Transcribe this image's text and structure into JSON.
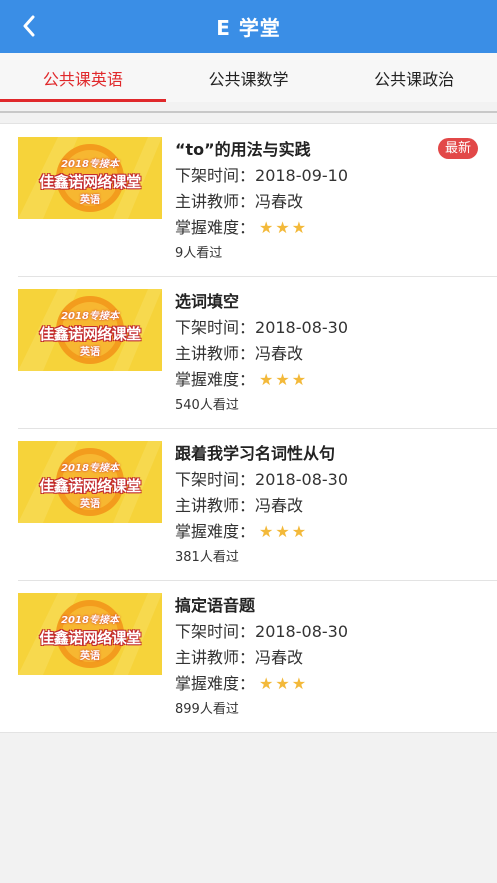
{
  "header": {
    "title": "E 学堂",
    "back_icon": "chevron-left-icon"
  },
  "tabs": [
    {
      "label": "公共课英语",
      "active": true
    },
    {
      "label": "公共课数学",
      "active": false
    },
    {
      "label": "公共课政治",
      "active": false
    }
  ],
  "thumbnail": {
    "year_text": "2018专接本",
    "title_text": "佳鑫诺网络课堂",
    "subject_text": "英语"
  },
  "courses": [
    {
      "title": "“to”的用法与实践",
      "badge": "最新",
      "offline_label": "下架时间：",
      "offline_date": "2018-09-10",
      "teacher_label": "主讲教师：",
      "teacher": "冯春改",
      "difficulty_label": "掌握难度：",
      "stars": "★★★",
      "views": "9人看过"
    },
    {
      "title": "选词填空",
      "offline_label": "下架时间：",
      "offline_date": "2018-08-30",
      "teacher_label": "主讲教师：",
      "teacher": "冯春改",
      "difficulty_label": "掌握难度：",
      "stars": "★★★",
      "views": "540人看过"
    },
    {
      "title": "跟着我学习名词性从句",
      "offline_label": "下架时间：",
      "offline_date": "2018-08-30",
      "teacher_label": "主讲教师：",
      "teacher": "冯春改",
      "difficulty_label": "掌握难度：",
      "stars": "★★★",
      "views": "381人看过"
    },
    {
      "title": "搞定语音题",
      "offline_label": "下架时间：",
      "offline_date": "2018-08-30",
      "teacher_label": "主讲教师：",
      "teacher": "冯春改",
      "difficulty_label": "掌握难度：",
      "stars": "★★★",
      "views": "899人看过"
    }
  ],
  "colors": {
    "nav": "#3a8ee6",
    "accent": "#e0282b",
    "badge": "#e24848",
    "star": "#f3b93a"
  }
}
